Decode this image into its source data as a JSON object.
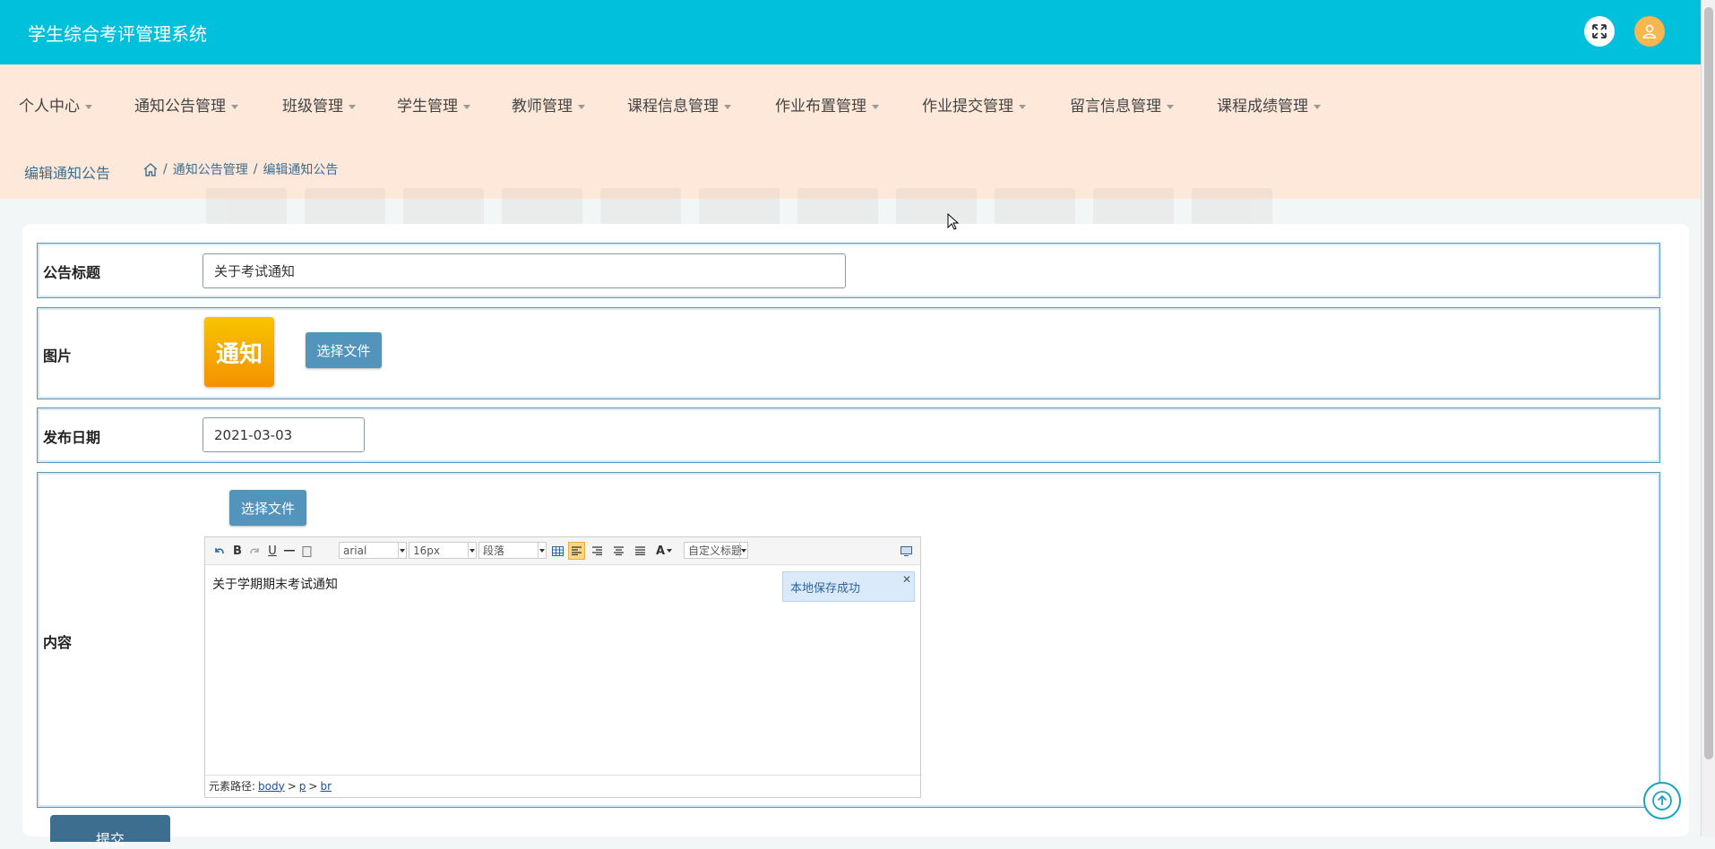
{
  "header": {
    "app_title": "学生综合考评管理系统",
    "fullscreen_icon": "expand-icon",
    "user_icon": "user-icon",
    "accent_color": "#00c0dc"
  },
  "nav": {
    "items": [
      "个人中心",
      "通知公告管理",
      "班级管理",
      "学生管理",
      "教师管理",
      "课程信息管理",
      "作业布置管理",
      "作业提交管理",
      "留言信息管理",
      "课程成绩管理"
    ]
  },
  "breadcrumb": {
    "page_title": "编辑通知公告",
    "home_icon": "home-icon",
    "items": [
      "通知公告管理",
      "编辑通知公告"
    ],
    "separator": "/"
  },
  "form": {
    "title_label": "公告标题",
    "title_value": "关于考试通知",
    "image_label": "图片",
    "image_text": "通知",
    "choose_file": "选择文件",
    "date_label": "发布日期",
    "date_value": "2021-03-03",
    "content_label": "内容",
    "content_choose_file": "选择文件",
    "submit": "提交"
  },
  "editor": {
    "font_family": "arial",
    "font_size": "16px",
    "paragraph": "段落",
    "custom_title": "自定义标题",
    "content": "关于学期期末考试通知",
    "save_tip": "本地保存成功",
    "status_prefix": "元素路径:",
    "path": [
      "body",
      "p",
      "br"
    ]
  }
}
